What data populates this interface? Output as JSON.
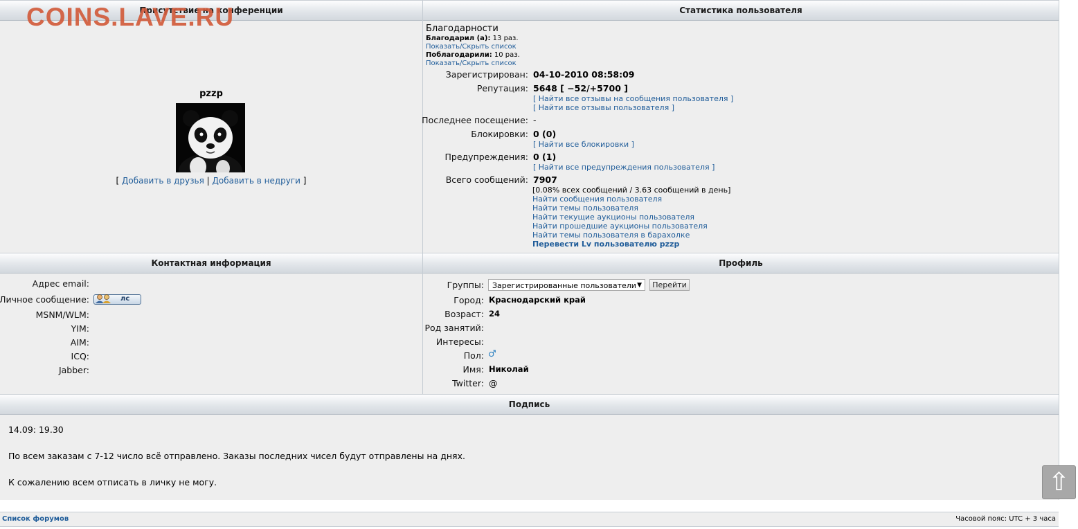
{
  "watermark": "COINS.LAVE.RU",
  "sections": {
    "presence": "Присутствие на конференции",
    "stats": "Статистика пользователя",
    "contact": "Контактная информация",
    "profile": "Профиль",
    "signature": "Подпись"
  },
  "user": {
    "name": "pzzp",
    "add_friend": "Добавить в друзья",
    "add_foe": "Добавить в недруги",
    "bracket_open": "[",
    "bracket_close": "]",
    "separator": "|"
  },
  "thanks": {
    "title": "Благодарности",
    "thanked_label": "Благодарил (а):",
    "thanked_value": "13 раз.",
    "toggle1": "Показать/Скрыть список",
    "received_label": "Поблагодарили:",
    "received_value": "10 раз.",
    "toggle2": "Показать/Скрыть список"
  },
  "stats": {
    "registered_label": "Зарегистрирован:",
    "registered_value": "04-10-2010 08:58:09",
    "reputation_label": "Репутация:",
    "reputation_value": "5648 [ −52/+5700 ]",
    "rep_link1": "[ Найти все отзывы на сообщения пользователя ]",
    "rep_link2": "[ Найти все отзывы пользователя ]",
    "last_visit_label": "Последнее посещение:",
    "last_visit_value": "-",
    "bans_label": "Блокировки:",
    "bans_value": "0 (0)",
    "bans_link": "[ Найти все блокировки ]",
    "warnings_label": "Предупреждения:",
    "warnings_value": "0 (1)",
    "warnings_link": "[ Найти все предупреждения пользователя ]",
    "posts_label": "Всего сообщений:",
    "posts_value": "7907",
    "posts_detail": "[0.08% всех сообщений / 3.63 сообщений в день]",
    "links": [
      "Найти сообщения пользователя",
      "Найти темы пользователя",
      "Найти текущие аукционы пользователя",
      "Найти прошедшие аукционы пользователя",
      "Найти темы пользователя в барахолке"
    ],
    "transfer_link": "Перевести Lv пользователю pzzp"
  },
  "contact": {
    "email_label": "Адрес email:",
    "pm_label": "Личное сообщение:",
    "pm_button": "лс",
    "msn_label": "MSNM/WLM:",
    "yim_label": "YIM:",
    "aim_label": "AIM:",
    "icq_label": "ICQ:",
    "jabber_label": "Jabber:"
  },
  "profile": {
    "groups_label": "Группы:",
    "groups_selected": "Зарегистрированные пользователи",
    "go_button": "Перейти",
    "city_label": "Город:",
    "city_value": "Краснодарский край",
    "age_label": "Возраст:",
    "age_value": "24",
    "occupation_label": "Род занятий:",
    "interests_label": "Интересы:",
    "gender_label": "Пол:",
    "gender_symbol": "♂",
    "name_label": "Имя:",
    "name_value": "Николай",
    "twitter_label": "Twitter:",
    "twitter_value": "@"
  },
  "signature": {
    "line1": "14.09: 19.30",
    "line2": "По всем заказам с 7-12 число всё отправлено. Заказы последних чисел будут отправлены на днях.",
    "line3": "К сожалению всем отписать в личку не могу."
  },
  "footer": {
    "forum_list": "Список форумов",
    "timezone": "Часовой пояс: UTC + 3 часа"
  },
  "scroll_top_symbol": "⇧",
  "colors": {
    "link": "#1f5c99",
    "watermark": "#d25c3c",
    "header_bg": "#dfe3e8",
    "panel_bg": "#eeeeee"
  }
}
